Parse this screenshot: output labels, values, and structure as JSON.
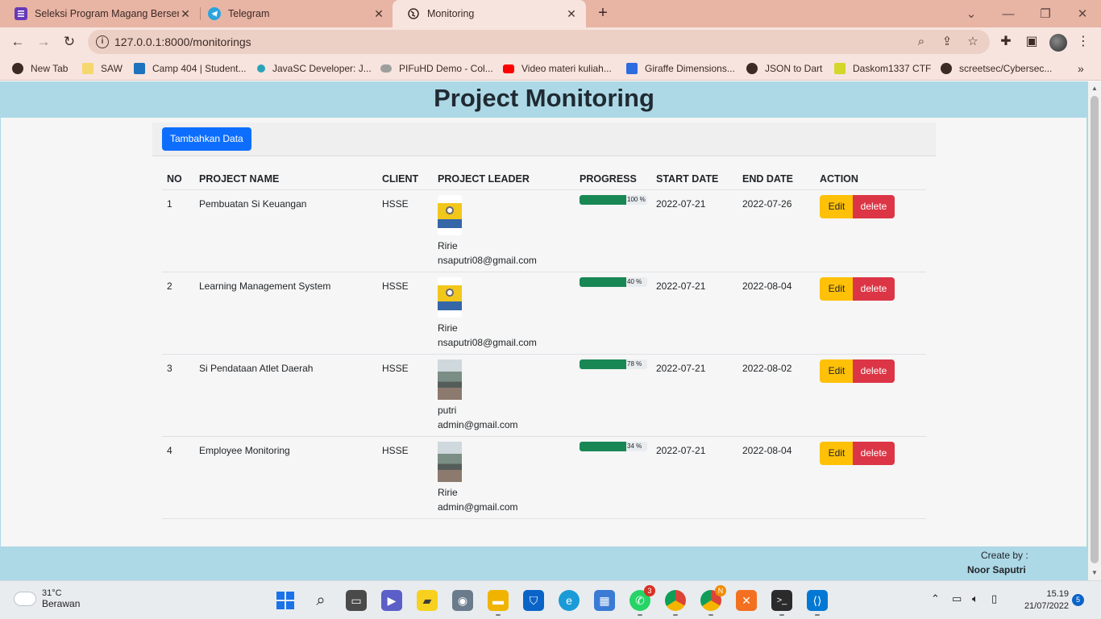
{
  "browser": {
    "tabs": [
      {
        "title": "Seleksi Program Magang Bersert",
        "active": false
      },
      {
        "title": "Telegram",
        "active": false
      },
      {
        "title": "Monitoring",
        "active": true
      }
    ],
    "url": "127.0.0.1:8000/monitorings",
    "bookmarks": [
      "New Tab",
      "SAW",
      "Camp 404 | Student...",
      "JavaSC Developer: J...",
      "PIFuHD Demo - Col...",
      "Video materi kuliah...",
      "Giraffe Dimensions...",
      "JSON to Dart",
      "Daskom1337 CTF",
      "screetsec/Cybersec..."
    ],
    "bookmark_more": "»"
  },
  "page": {
    "title": "Project Monitoring",
    "add_button": "Tambahkan Data",
    "columns": [
      "NO",
      "PROJECT NAME",
      "CLIENT",
      "PROJECT LEADER",
      "PROGRESS",
      "START DATE",
      "END DATE",
      "ACTION"
    ],
    "rows": [
      {
        "no": "1",
        "name": "Pembuatan Si Keuangan",
        "client": "HSSE",
        "leader_name": "Ririe",
        "leader_email": "nsaputri08@gmail.com",
        "leader_photo": "minion",
        "progress": 100,
        "progress_label": "100 %",
        "start": "2022-07-21",
        "end": "2022-07-26",
        "edit": "Edit",
        "delete": "delete"
      },
      {
        "no": "2",
        "name": "Learning Management System",
        "client": "HSSE",
        "leader_name": "Ririe",
        "leader_email": "nsaputri08@gmail.com",
        "leader_photo": "minion",
        "progress": 40,
        "progress_label": "40 %",
        "start": "2022-07-21",
        "end": "2022-08-04",
        "edit": "Edit",
        "delete": "delete"
      },
      {
        "no": "3",
        "name": "Si Pendataan Atlet Daerah",
        "client": "HSSE",
        "leader_name": "putri",
        "leader_email": "admin@gmail.com",
        "leader_photo": "photo",
        "progress": 78,
        "progress_label": "78 %",
        "start": "2022-07-21",
        "end": "2022-08-02",
        "edit": "Edit",
        "delete": "delete"
      },
      {
        "no": "4",
        "name": "Employee Monitoring",
        "client": "HSSE",
        "leader_name": "Ririe",
        "leader_email": "admin@gmail.com",
        "leader_photo": "photo",
        "progress": 34,
        "progress_label": "34 %",
        "start": "2022-07-21",
        "end": "2022-08-04",
        "edit": "Edit",
        "delete": "delete"
      }
    ],
    "footer": {
      "label": "Create by :",
      "author": "Noor Saputri"
    }
  },
  "taskbar": {
    "weather_temp": "31°C",
    "weather_desc": "Berawan",
    "whatsapp_badge": "3",
    "chrome_badge": "N",
    "time": "15.19",
    "date": "21/07/2022",
    "notifications": "5"
  },
  "colors": {
    "header_bg": "#add8e6",
    "primary": "#0d6efd",
    "success": "#198754",
    "warning": "#ffc107",
    "danger": "#dc3545",
    "browser_frame": "#e8b4a4"
  }
}
